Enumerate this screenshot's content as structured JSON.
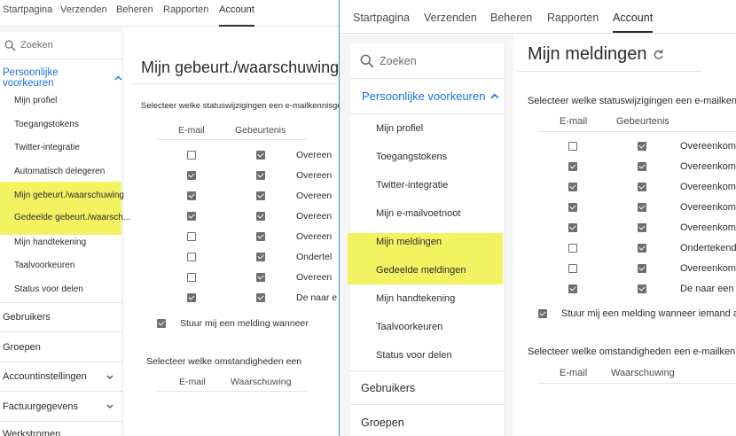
{
  "nav": {
    "tabs": [
      "Startpagina",
      "Verzenden",
      "Beheren",
      "Rapporten",
      "Account"
    ],
    "active_tab": "Account"
  },
  "left": {
    "search_placeholder": "Zoeken",
    "section_label": "Persoonlijke voorkeuren",
    "items": [
      "Mijn profiel",
      "Toegangstokens",
      "Twitter-integratie",
      "Automatisch delegeren",
      "Mijn gebeurt./waarschuwing",
      "Gedeelde gebeurt./waarsch...",
      "Mijn handtekening",
      "Taalvoorkeuren",
      "Status voor delen"
    ],
    "groups": [
      "Gebruikers",
      "Groepen",
      "Accountinstellingen",
      "Factuurgegevens",
      "Werkstromen"
    ],
    "title": "Mijn gebeurt./waarschuwing",
    "section1": "Selecteer welke statuswijzigingen een e-mailkennisgev",
    "col_email": "E-mail",
    "col_event": "Gebeurtenis",
    "rows": [
      {
        "email": false,
        "event": true,
        "label": "Overeen"
      },
      {
        "email": true,
        "event": true,
        "label": "Overeen"
      },
      {
        "email": true,
        "event": true,
        "label": "Overeen"
      },
      {
        "email": true,
        "event": true,
        "label": "Overeen"
      },
      {
        "email": false,
        "event": true,
        "label": "Overeen"
      },
      {
        "email": false,
        "event": true,
        "label": "Ondertel"
      },
      {
        "email": false,
        "event": true,
        "label": "Overeen"
      },
      {
        "email": true,
        "event": true,
        "label": "De naar e"
      }
    ],
    "notify_label": "Stuur mij een melding wanneer",
    "section2": "Selecteer welke omstandigheden een",
    "col_warning": "Waarschuwing"
  },
  "right": {
    "search_placeholder": "Zoeken",
    "section_label": "Persoonlijke voorkeuren",
    "items": [
      "Mijn profiel",
      "Toegangstokens",
      "Twitter-integratie",
      "Mijn e-mailvoetnoot",
      "Mijn meldingen",
      "Gedeelde meldingen",
      "Mijn handtekening",
      "Taalvoorkeuren",
      "Status voor delen"
    ],
    "groups": [
      "Gebruikers",
      "Groepen"
    ],
    "title": "Mijn meldingen",
    "section1": "Selecteer welke statuswijzigingen een e-mailkennisgev",
    "col_email": "E-mail",
    "col_event": "Gebeurtenis",
    "rows": [
      {
        "email": false,
        "event": true,
        "label": "Overeenkoms"
      },
      {
        "email": true,
        "event": true,
        "label": "Overeenkoms"
      },
      {
        "email": true,
        "event": true,
        "label": "Overeenkoms"
      },
      {
        "email": true,
        "event": true,
        "label": "Overeenkoms"
      },
      {
        "email": true,
        "event": true,
        "label": "Overeenkoms"
      },
      {
        "email": false,
        "event": true,
        "label": "Ondertekende"
      },
      {
        "email": false,
        "event": true,
        "label": "Overeenkoms"
      },
      {
        "email": true,
        "event": true,
        "label": "De naar een c"
      }
    ],
    "notify_label": "Stuur mij een melding wanneer iemand an",
    "section2": "Selecteer welke omstandigheden een e-mailkennisgev",
    "col_warning": "Waarschuwing"
  },
  "colors": {
    "accent": "#1473e6",
    "highlight": "#f3f362",
    "separator": "#2f9bbf"
  },
  "icons": [
    "search-icon",
    "chevron-up-icon",
    "chevron-down-icon",
    "refresh-icon"
  ]
}
